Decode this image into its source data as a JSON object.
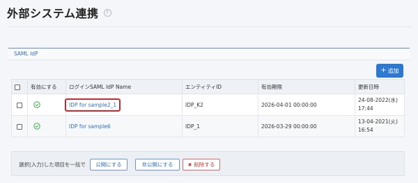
{
  "page": {
    "title": "外部システム連携",
    "help_icon": "question-circle-icon"
  },
  "section": {
    "label": "SAML IdP"
  },
  "toolbar": {
    "add_label": "追加",
    "add_icon": "plus-icon"
  },
  "table": {
    "headers": {
      "valid": "有効にする",
      "name": "ログインSAML IdP Name",
      "entity": "エンティティID",
      "expiry": "有効期限",
      "updated": "更新日時"
    },
    "rows": [
      {
        "checked": false,
        "valid": true,
        "name": "IDP for sample2_1",
        "entity_id": "IDP_K2",
        "expiry": "2026-04-01 00:00:00",
        "updated_date": "24-08-2022(水)",
        "updated_time": "17:44"
      },
      {
        "checked": false,
        "valid": true,
        "name": "IDP for sample6",
        "entity_id": "IDP_1",
        "expiry": "2026-03-29 00:00:00",
        "updated_date": "13-04-2021(火)",
        "updated_time": "16:54"
      }
    ]
  },
  "bulk": {
    "label": "選択(入力)した項目を一括で",
    "publish_label": "公開にする",
    "unpublish_label": "非公開にする",
    "delete_label": "削除する"
  },
  "colors": {
    "accent": "#2f78d0",
    "link": "#2f6fc4",
    "valid_check": "#3cae4a",
    "highlight_border": "#d6222a"
  }
}
